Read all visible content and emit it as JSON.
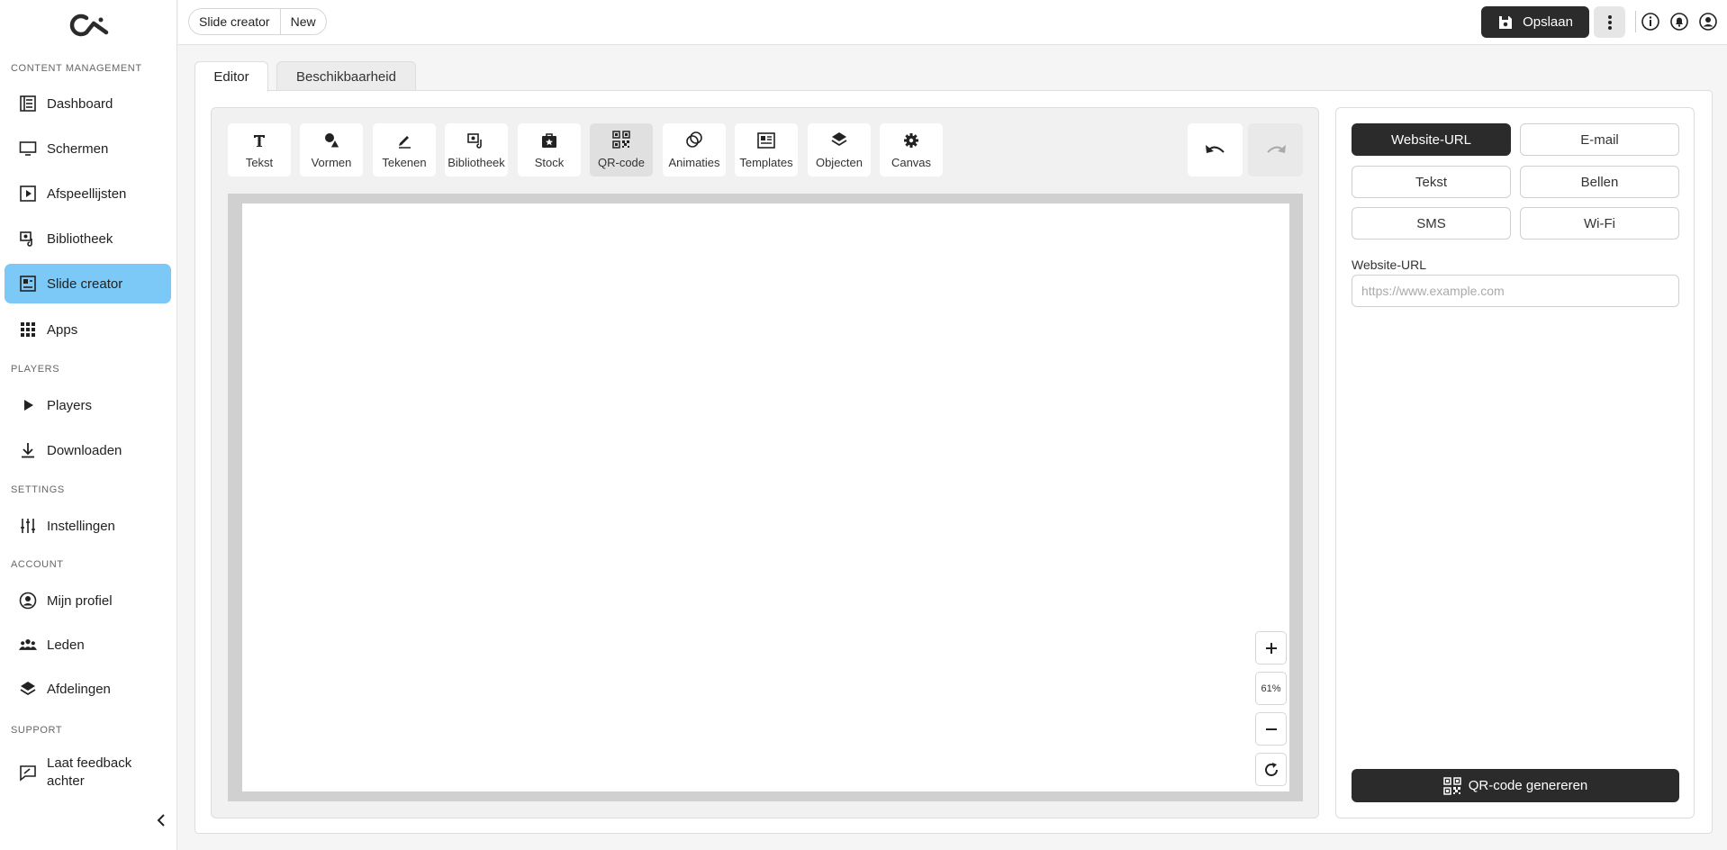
{
  "sidebar": {
    "sections": {
      "content": "CONTENT MANAGEMENT",
      "players": "PLAYERS",
      "settings": "SETTINGS",
      "account": "ACCOUNT",
      "support": "SUPPORT"
    },
    "items": [
      {
        "label": "Dashboard",
        "icon": "dashboard-icon"
      },
      {
        "label": "Schermen",
        "icon": "monitor-icon"
      },
      {
        "label": "Afspeellijsten",
        "icon": "playlist-icon"
      },
      {
        "label": "Bibliotheek",
        "icon": "library-icon"
      },
      {
        "label": "Slide creator",
        "icon": "slide-creator-icon"
      },
      {
        "label": "Apps",
        "icon": "apps-grid-icon"
      },
      {
        "label": "Players",
        "icon": "play-icon"
      },
      {
        "label": "Downloaden",
        "icon": "download-icon"
      },
      {
        "label": "Instellingen",
        "icon": "sliders-icon"
      },
      {
        "label": "Mijn profiel",
        "icon": "profile-icon"
      },
      {
        "label": "Leden",
        "icon": "members-icon"
      },
      {
        "label": "Afdelingen",
        "icon": "layers-icon"
      },
      {
        "label": "Laat feedback achter",
        "icon": "feedback-icon"
      }
    ],
    "active_item": "Slide creator"
  },
  "header": {
    "breadcrumb": [
      "Slide creator",
      "New"
    ],
    "save_label": "Opslaan"
  },
  "tabs": [
    {
      "label": "Editor",
      "active": true
    },
    {
      "label": "Beschikbaarheid",
      "active": false
    }
  ],
  "toolbar": {
    "tools": [
      {
        "label": "Tekst",
        "icon": "text-icon"
      },
      {
        "label": "Vormen",
        "icon": "shapes-icon"
      },
      {
        "label": "Tekenen",
        "icon": "draw-icon"
      },
      {
        "label": "Bibliotheek",
        "icon": "library-icon"
      },
      {
        "label": "Stock",
        "icon": "stock-icon"
      },
      {
        "label": "QR-code",
        "icon": "qr-code-icon"
      },
      {
        "label": "Animaties",
        "icon": "animations-icon"
      },
      {
        "label": "Templates",
        "icon": "templates-icon"
      },
      {
        "label": "Objecten",
        "icon": "objects-icon"
      },
      {
        "label": "Canvas",
        "icon": "gear-icon"
      }
    ],
    "selected_tool": "QR-code"
  },
  "zoom": {
    "level": "61%"
  },
  "qr_panel": {
    "types": [
      "Website-URL",
      "E-mail",
      "Tekst",
      "Bellen",
      "SMS",
      "Wi-Fi"
    ],
    "selected_type": "Website-URL",
    "field_label": "Website-URL",
    "field_placeholder": "https://www.example.com",
    "field_value": "",
    "generate_label": "QR-code genereren"
  },
  "colors": {
    "accent": "#7cc8f7",
    "dark": "#2b2b2b"
  }
}
